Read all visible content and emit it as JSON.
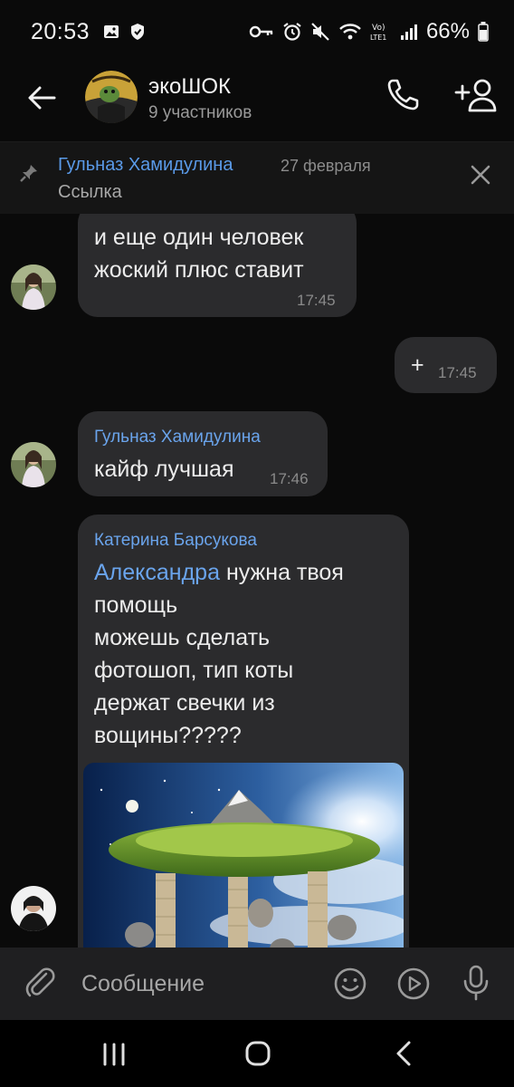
{
  "status_bar": {
    "time": "20:53",
    "battery": "66%",
    "icons": [
      "gallery-icon",
      "shield-icon",
      "key-icon",
      "alarm-icon",
      "mute-icon",
      "wifi-icon",
      "volte-icon",
      "signal-icon",
      "battery-icon"
    ]
  },
  "header": {
    "title": "экоШОК",
    "subtitle": "9 участников"
  },
  "pinned": {
    "author": "Гульназ Хамидулина",
    "date": "27 февраля",
    "text": "Ссылка"
  },
  "messages": [
    {
      "line1": "и еще один человек",
      "line2": "жоский плюс ставит",
      "time": "17:45"
    },
    {
      "text": "+",
      "time": "17:45",
      "outgoing": true
    },
    {
      "author": "Гульназ Хамидулина",
      "text": "кайф лучшая",
      "time": "17:46"
    },
    {
      "author": "Катерина Барсукова",
      "mention": "Александра",
      "line1_rest": " нужна твоя",
      "line2": "помощь",
      "line3": "можешь сделать",
      "line4": "фотошоп, тип коты",
      "line5": "держат свечки из",
      "line6": "вощины?????"
    }
  ],
  "composer": {
    "placeholder": "Сообщение"
  },
  "colors": {
    "accent": "#6aa4ec",
    "bubble": "#2b2b2d",
    "background": "#0a0a0a"
  }
}
